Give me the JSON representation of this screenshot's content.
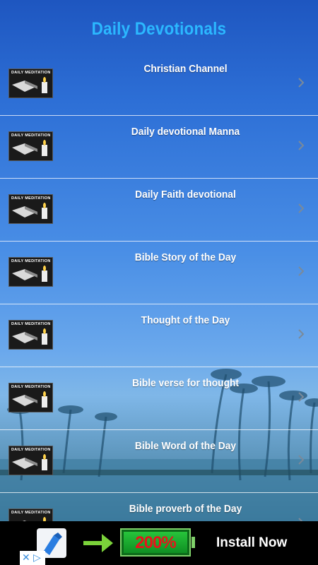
{
  "app": {
    "title": "Daily Devotionals"
  },
  "list": {
    "items": [
      {
        "label": "Christian Channel",
        "thumb_caption": "DAILY MEDITATION"
      },
      {
        "label": "Daily devotional Manna",
        "thumb_caption": "DAILY MEDITATION"
      },
      {
        "label": "Daily Faith devotional",
        "thumb_caption": "DAILY MEDITATION"
      },
      {
        "label": "Bible Story of the Day",
        "thumb_caption": "DAILY MEDITATION"
      },
      {
        "label": "Thought of the Day",
        "thumb_caption": "DAILY MEDITATION"
      },
      {
        "label": "Bible verse for thought",
        "thumb_caption": "DAILY MEDITATION"
      },
      {
        "label": "Bible Word of the Day",
        "thumb_caption": "DAILY MEDITATION"
      },
      {
        "label": "Bible proverb of the Day",
        "thumb_caption": "DAILY MEDITATION"
      }
    ]
  },
  "ad": {
    "battery_value": "200%",
    "cta": "Install Now"
  },
  "colors": {
    "title": "#2bb8ff",
    "row_text": "#ffffff",
    "ad_bg": "#000000"
  }
}
